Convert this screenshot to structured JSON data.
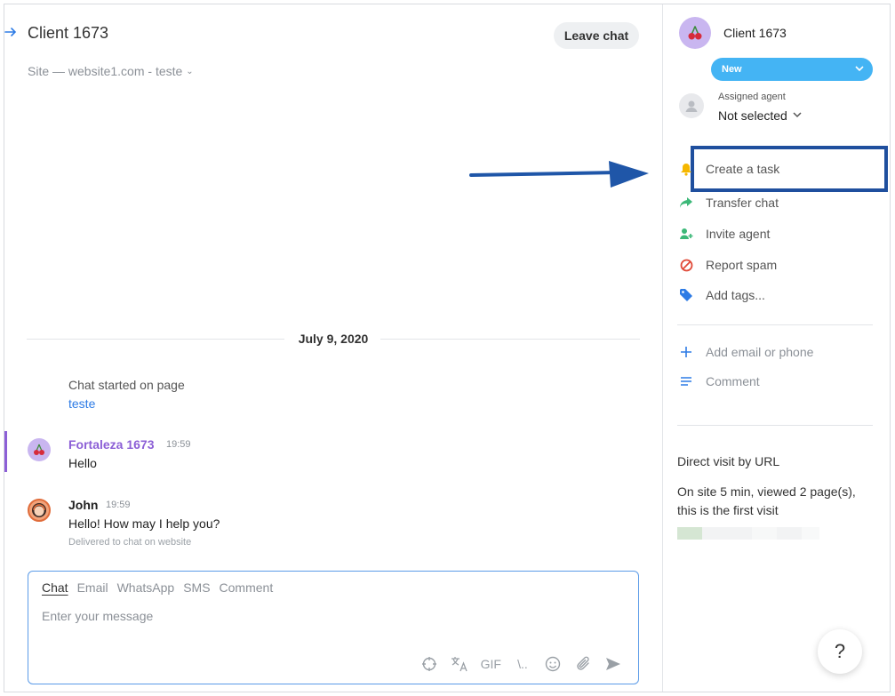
{
  "chat": {
    "title": "Client 1673",
    "leave_label": "Leave chat",
    "site_line": "Site — website1.com - teste",
    "date_separator": "July 9, 2020",
    "started_text": "Chat started on page",
    "started_link": "teste",
    "messages": [
      {
        "name": "Fortaleza 1673",
        "time": "19:59",
        "text": "Hello",
        "name_color": "#8c5fd6"
      },
      {
        "name": "John",
        "time": "19:59",
        "text": "Hello! How may I help you?",
        "status": "Delivered to chat on website",
        "name_color": "#222222"
      }
    ]
  },
  "composer": {
    "tabs": [
      "Chat",
      "Email",
      "WhatsApp",
      "SMS",
      "Comment"
    ],
    "active_tab": "Chat",
    "placeholder": "Enter your message",
    "tools": [
      "target-icon",
      "translate-icon",
      "GIF",
      "\\..",
      "emoji-icon",
      "attach-icon",
      "send-icon"
    ],
    "gif_label": "GIF",
    "shortcut_label": "\\.."
  },
  "sidebar": {
    "client_name": "Client 1673",
    "status": "New",
    "status_color": "#44b4f4",
    "assigned_label": "Assigned agent",
    "assigned_value": "Not selected",
    "actions": [
      {
        "label": "Create a task",
        "icon": "bell-icon",
        "color": "#f5b700"
      },
      {
        "label": "Transfer chat",
        "icon": "share-arrow-icon",
        "color": "#3cb878"
      },
      {
        "label": "Invite agent",
        "icon": "add-user-icon",
        "color": "#3cb878"
      },
      {
        "label": "Report spam",
        "icon": "block-icon",
        "color": "#e04b3a"
      },
      {
        "label": "Add tags...",
        "icon": "tag-icon",
        "color": "#2d7be5"
      }
    ],
    "extras": [
      {
        "label": "Add email or phone",
        "icon": "plus-icon"
      },
      {
        "label": "Comment",
        "icon": "lines-icon"
      }
    ],
    "visit_title": "Direct visit by URL",
    "visit_info": "On site 5 min, viewed 2 page(s), this is the first visit"
  },
  "help_label": "?",
  "colors": {
    "accent": "#2d7be5",
    "highlight_box": "#1f4f9e"
  }
}
